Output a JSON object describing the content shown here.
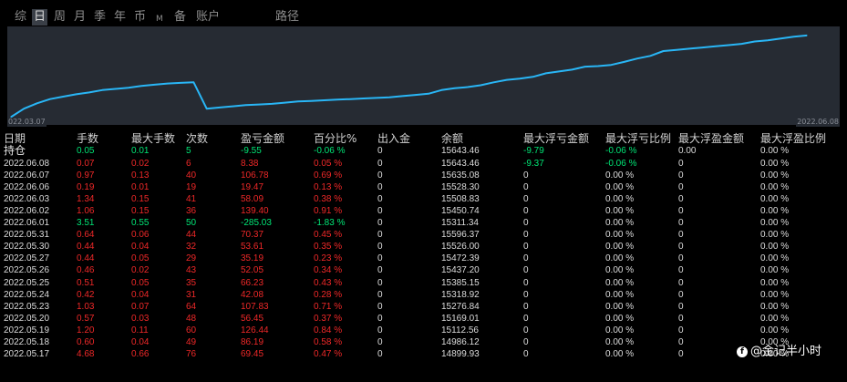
{
  "tabs": [
    {
      "label": "综",
      "active": false
    },
    {
      "label": "日",
      "active": true
    },
    {
      "label": "周",
      "active": false
    },
    {
      "label": "月",
      "active": false
    },
    {
      "label": "季",
      "active": false
    },
    {
      "label": "年",
      "active": false
    },
    {
      "label": "币",
      "active": false
    },
    {
      "label": "M",
      "active": false
    },
    {
      "label": "备",
      "active": false
    },
    {
      "label": "账户",
      "active": false
    },
    {
      "label": "路径",
      "active": false
    }
  ],
  "colors": {
    "line": "#29b6f6",
    "chart_bg": "#262b33",
    "positive": "#00e676",
    "negative": "#ef2828",
    "text": "#dcdcdc"
  },
  "chart_data": {
    "type": "line",
    "x_start_label": "022.03.07",
    "x_end_label": "2022.06.08",
    "x": [
      "2022.03.07",
      "2022.03.08",
      "2022.03.09",
      "2022.03.10",
      "2022.03.11",
      "2022.03.14",
      "2022.03.15",
      "2022.03.16",
      "2022.03.17",
      "2022.03.18",
      "2022.03.21",
      "2022.03.22",
      "2022.03.23",
      "2022.03.24",
      "2022.03.25",
      "2022.03.28",
      "2022.03.29",
      "2022.03.30",
      "2022.03.31",
      "2022.04.01",
      "2022.04.06",
      "2022.04.07",
      "2022.04.08",
      "2022.04.11",
      "2022.04.12",
      "2022.04.13",
      "2022.04.14",
      "2022.04.15",
      "2022.04.18",
      "2022.04.19",
      "2022.04.20",
      "2022.04.21",
      "2022.04.22",
      "2022.04.25",
      "2022.04.26",
      "2022.04.27",
      "2022.04.28",
      "2022.04.29",
      "2022.05.05",
      "2022.05.06",
      "2022.05.09",
      "2022.05.10",
      "2022.05.11",
      "2022.05.12",
      "2022.05.13",
      "2022.05.16",
      "2022.05.17",
      "2022.05.18",
      "2022.05.19",
      "2022.05.20",
      "2022.05.23",
      "2022.05.24",
      "2022.05.25",
      "2022.05.26",
      "2022.05.27",
      "2022.05.30",
      "2022.05.31",
      "2022.06.01",
      "2022.06.02",
      "2022.06.06",
      "2022.06.07",
      "2022.06.08"
    ],
    "values": [
      13500,
      13640,
      13730,
      13800,
      13840,
      13880,
      13910,
      13950,
      13970,
      13990,
      14020,
      14040,
      14060,
      14070,
      14080,
      13640,
      13660,
      13680,
      13700,
      13710,
      13720,
      13740,
      13760,
      13770,
      13780,
      13790,
      13800,
      13810,
      13820,
      13830,
      13850,
      13870,
      13890,
      13950,
      13980,
      14000,
      14030,
      14080,
      14120,
      14140,
      14170,
      14230,
      14260,
      14290,
      14340,
      14350,
      14370,
      14420,
      14476,
      14520,
      14600,
      14620,
      14640,
      14660,
      14679,
      14700,
      14720,
      14760,
      14780,
      14810,
      14840,
      14860
    ],
    "ylim": [
      13400,
      14950
    ],
    "grid": false,
    "legend": "none"
  },
  "table": {
    "headers": [
      "日期",
      "手数",
      "最大手数",
      "次数",
      "盈亏金额",
      "百分比%",
      "出入金",
      "余额",
      "最大浮亏金额",
      "最大浮亏比例",
      "最大浮盈金额",
      "最大浮盈比例"
    ],
    "holding": {
      "date": "持仓",
      "lots": "0.05",
      "max_lots": "0.01",
      "count": "5",
      "pnl": "-9.55",
      "pct": "-0.06 %",
      "io": "0",
      "balance": "15643.46",
      "max_loss": "-9.79",
      "max_loss_pct": "-0.06 %",
      "max_gain": "0.00",
      "max_gain_pct": "0.00 %"
    },
    "rows": [
      {
        "date": "2022.06.08",
        "lots": "0.07",
        "max_lots": "0.02",
        "count": "6",
        "pnl": "8.38",
        "pct": "0.05 %",
        "io": "0",
        "balance": "15643.46",
        "max_loss": "-9.37",
        "max_loss_pct": "-0.06 %",
        "max_gain": "0",
        "max_gain_pct": "0.00 %",
        "tone": "red"
      },
      {
        "date": "2022.06.07",
        "lots": "0.97",
        "max_lots": "0.13",
        "count": "40",
        "pnl": "106.78",
        "pct": "0.69 %",
        "io": "0",
        "balance": "15635.08",
        "max_loss": "0",
        "max_loss_pct": "0.00 %",
        "max_gain": "0",
        "max_gain_pct": "0.00 %",
        "tone": "red"
      },
      {
        "date": "2022.06.06",
        "lots": "0.19",
        "max_lots": "0.01",
        "count": "19",
        "pnl": "19.47",
        "pct": "0.13 %",
        "io": "0",
        "balance": "15528.30",
        "max_loss": "0",
        "max_loss_pct": "0.00 %",
        "max_gain": "0",
        "max_gain_pct": "0.00 %",
        "tone": "red"
      },
      {
        "date": "2022.06.03",
        "lots": "1.34",
        "max_lots": "0.15",
        "count": "41",
        "pnl": "58.09",
        "pct": "0.38 %",
        "io": "0",
        "balance": "15508.83",
        "max_loss": "0",
        "max_loss_pct": "0.00 %",
        "max_gain": "0",
        "max_gain_pct": "0.00 %",
        "tone": "red"
      },
      {
        "date": "2022.06.02",
        "lots": "1.06",
        "max_lots": "0.15",
        "count": "36",
        "pnl": "139.40",
        "pct": "0.91 %",
        "io": "0",
        "balance": "15450.74",
        "max_loss": "0",
        "max_loss_pct": "0.00 %",
        "max_gain": "0",
        "max_gain_pct": "0.00 %",
        "tone": "red"
      },
      {
        "date": "2022.06.01",
        "lots": "3.51",
        "max_lots": "0.55",
        "count": "50",
        "pnl": "-285.03",
        "pct": "-1.83 %",
        "io": "0",
        "balance": "15311.34",
        "max_loss": "0",
        "max_loss_pct": "0.00 %",
        "max_gain": "0",
        "max_gain_pct": "0.00 %",
        "tone": "green"
      },
      {
        "date": "2022.05.31",
        "lots": "0.64",
        "max_lots": "0.06",
        "count": "44",
        "pnl": "70.37",
        "pct": "0.45 %",
        "io": "0",
        "balance": "15596.37",
        "max_loss": "0",
        "max_loss_pct": "0.00 %",
        "max_gain": "0",
        "max_gain_pct": "0.00 %",
        "tone": "red"
      },
      {
        "date": "2022.05.30",
        "lots": "0.44",
        "max_lots": "0.04",
        "count": "32",
        "pnl": "53.61",
        "pct": "0.35 %",
        "io": "0",
        "balance": "15526.00",
        "max_loss": "0",
        "max_loss_pct": "0.00 %",
        "max_gain": "0",
        "max_gain_pct": "0.00 %",
        "tone": "red"
      },
      {
        "date": "2022.05.27",
        "lots": "0.44",
        "max_lots": "0.05",
        "count": "29",
        "pnl": "35.19",
        "pct": "0.23 %",
        "io": "0",
        "balance": "15472.39",
        "max_loss": "0",
        "max_loss_pct": "0.00 %",
        "max_gain": "0",
        "max_gain_pct": "0.00 %",
        "tone": "red"
      },
      {
        "date": "2022.05.26",
        "lots": "0.46",
        "max_lots": "0.02",
        "count": "43",
        "pnl": "52.05",
        "pct": "0.34 %",
        "io": "0",
        "balance": "15437.20",
        "max_loss": "0",
        "max_loss_pct": "0.00 %",
        "max_gain": "0",
        "max_gain_pct": "0.00 %",
        "tone": "red"
      },
      {
        "date": "2022.05.25",
        "lots": "0.51",
        "max_lots": "0.05",
        "count": "35",
        "pnl": "66.23",
        "pct": "0.43 %",
        "io": "0",
        "balance": "15385.15",
        "max_loss": "0",
        "max_loss_pct": "0.00 %",
        "max_gain": "0",
        "max_gain_pct": "0.00 %",
        "tone": "red"
      },
      {
        "date": "2022.05.24",
        "lots": "0.42",
        "max_lots": "0.04",
        "count": "31",
        "pnl": "42.08",
        "pct": "0.28 %",
        "io": "0",
        "balance": "15318.92",
        "max_loss": "0",
        "max_loss_pct": "0.00 %",
        "max_gain": "0",
        "max_gain_pct": "0.00 %",
        "tone": "red"
      },
      {
        "date": "2022.05.23",
        "lots": "1.03",
        "max_lots": "0.07",
        "count": "64",
        "pnl": "107.83",
        "pct": "0.71 %",
        "io": "0",
        "balance": "15276.84",
        "max_loss": "0",
        "max_loss_pct": "0.00 %",
        "max_gain": "0",
        "max_gain_pct": "0.00 %",
        "tone": "red"
      },
      {
        "date": "2022.05.20",
        "lots": "0.57",
        "max_lots": "0.03",
        "count": "48",
        "pnl": "56.45",
        "pct": "0.37 %",
        "io": "0",
        "balance": "15169.01",
        "max_loss": "0",
        "max_loss_pct": "0.00 %",
        "max_gain": "0",
        "max_gain_pct": "0.00 %",
        "tone": "red"
      },
      {
        "date": "2022.05.19",
        "lots": "1.20",
        "max_lots": "0.11",
        "count": "60",
        "pnl": "126.44",
        "pct": "0.84 %",
        "io": "0",
        "balance": "15112.56",
        "max_loss": "0",
        "max_loss_pct": "0.00 %",
        "max_gain": "0",
        "max_gain_pct": "0.00 %",
        "tone": "red"
      },
      {
        "date": "2022.05.18",
        "lots": "0.60",
        "max_lots": "0.04",
        "count": "49",
        "pnl": "86.19",
        "pct": "0.58 %",
        "io": "0",
        "balance": "14986.12",
        "max_loss": "0",
        "max_loss_pct": "0.00 %",
        "max_gain": "0",
        "max_gain_pct": "0.00 %",
        "tone": "red"
      },
      {
        "date": "2022.05.17",
        "lots": "4.68",
        "max_lots": "0.66",
        "count": "76",
        "pnl": "69.45",
        "pct": "0.47 %",
        "io": "0",
        "balance": "14899.93",
        "max_loss": "0",
        "max_loss_pct": "0.00 %",
        "max_gain": "0",
        "max_gain_pct": "0.00 %",
        "tone": "red"
      }
    ]
  },
  "watermark": {
    "text": "@金记半小时"
  }
}
